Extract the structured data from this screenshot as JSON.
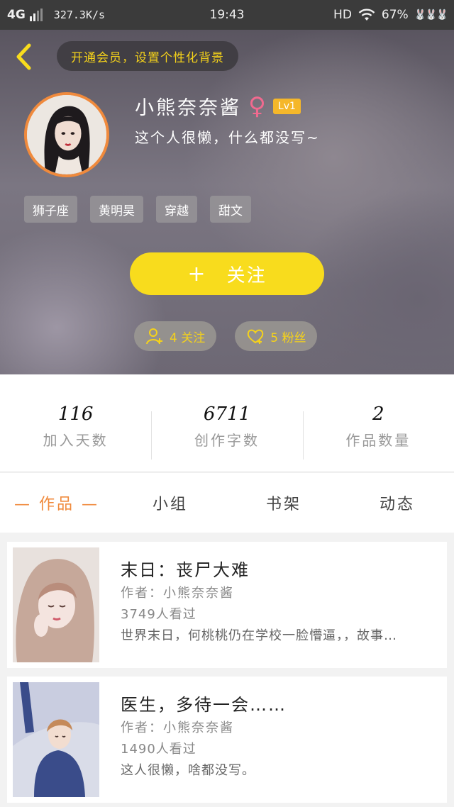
{
  "status_bar": {
    "network": "4G",
    "speed": "327.3K/s",
    "time": "19:43",
    "hd": "HD",
    "battery": "67%",
    "bunny_icons": "🐰🐰🐰"
  },
  "header": {
    "vip_prompt": "开通会员，设置个性化背景",
    "nickname": "小熊奈奈酱",
    "gender_symbol": "♀",
    "level": "Lv1",
    "bio": "这个人很懒，什么都没写~",
    "tags": [
      "狮子座",
      "黄明昊",
      "穿越",
      "甜文"
    ],
    "follow_plus": "+",
    "follow_label": "关注",
    "following_count": "4 关注",
    "fans_count": "5 粉丝"
  },
  "stats": [
    {
      "value": "116",
      "label": "加入天数"
    },
    {
      "value": "6711",
      "label": "创作字数"
    },
    {
      "value": "2",
      "label": "作品数量"
    }
  ],
  "tabs": [
    {
      "label": "— 作品 —",
      "active": true
    },
    {
      "label": "小组",
      "active": false
    },
    {
      "label": "书架",
      "active": false
    },
    {
      "label": "动态",
      "active": false
    }
  ],
  "works": [
    {
      "title": "末日：丧尸大难",
      "author": "作者：小熊奈奈酱",
      "views": "3749人看过",
      "desc": "世界末日，何桃桃仍在学校一脸懵逼，，故事…"
    },
    {
      "title": "医生，多待一会……",
      "author": "作者：小熊奈奈酱",
      "views": "1490人看过",
      "desc": "这人很懒，啥都没写。"
    }
  ],
  "colors": {
    "accent_orange": "#f08a3c",
    "accent_yellow": "#f8dc1d",
    "gender_pink": "#f06a8f"
  }
}
